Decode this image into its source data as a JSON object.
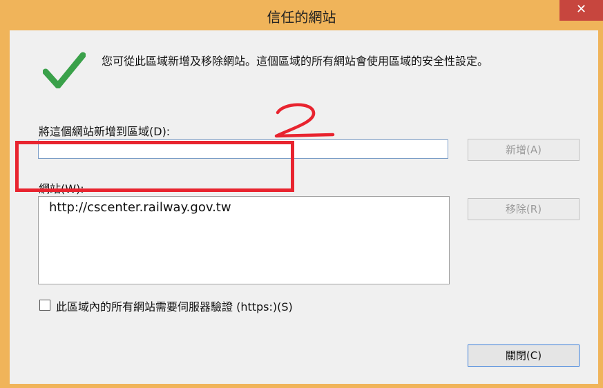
{
  "window": {
    "title": "信任的網站",
    "close_glyph": "✕"
  },
  "description": "您可從此區域新增及移除網站。這個區域的所有網站會使用區域的安全性設定。",
  "add_section": {
    "label": "將這個網站新增到區域(D):",
    "input_value": "",
    "add_button": "新增(A)"
  },
  "sites_section": {
    "label": "網站(W):",
    "items": [
      "http://cscenter.railway.gov.tw"
    ],
    "remove_button": "移除(R)"
  },
  "https_checkbox": {
    "label": "此區域內的所有網站需要伺服器驗證 (https:)(S)",
    "checked": false
  },
  "close_button": "關閉(C)",
  "icons": {
    "check": "check-icon"
  },
  "annotation": {
    "number": "2",
    "color": "#e8242f"
  }
}
